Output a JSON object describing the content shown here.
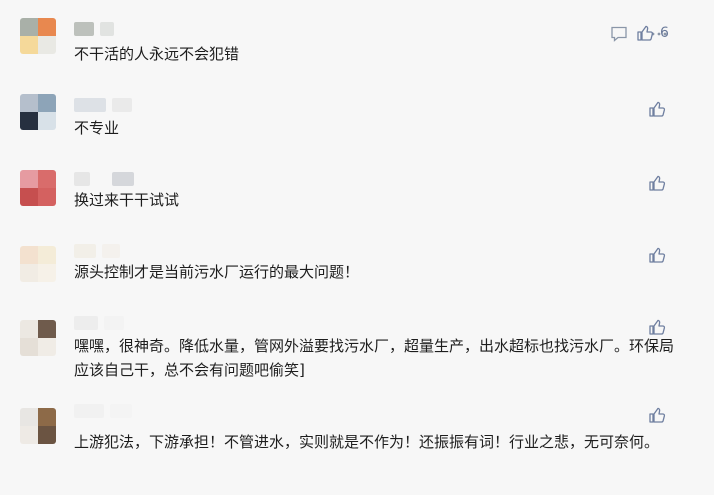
{
  "comments": [
    {
      "text": "不干活的人永远不会犯错",
      "likes": "6",
      "avatar_colors": [
        "#a9b0a8",
        "#e8884f",
        "#f5d99a",
        "#e9e9e4"
      ],
      "nick_colors": [
        "#8e968c",
        "#cfd3cf"
      ],
      "actions": true
    },
    {
      "text": "不专业",
      "likes": "",
      "avatar_colors": [
        "#b5bfcc",
        "#8da4b8",
        "#263040",
        "#d8e1e8"
      ],
      "nick_colors": [
        "#c9d0d8",
        "#e0e0e0"
      ],
      "actions": false
    },
    {
      "text": "换过来干干试试",
      "likes": "",
      "avatar_colors": [
        "#e69ba1",
        "#d96c6b",
        "#c64f4f",
        "#d46160"
      ],
      "nick_colors": [
        "#d9d9d9",
        "#b9bec4"
      ],
      "actions": false
    },
    {
      "text": "源头控制才是当前污水厂运行的最大问题！",
      "likes": "",
      "avatar_colors": [
        "#f3e1cf",
        "#f4ecd8",
        "#f1ece4",
        "#f6f1e8"
      ],
      "nick_colors": [
        "#efe9dd",
        "#f2ede6"
      ],
      "actions": false
    },
    {
      "text": "嘿嘿，很神奇。降低水量，管网外溢要找污水厂，超量生产，出水超标也找污水厂。环保局应该自己干，总不会有问题吧偷笑]",
      "likes": "",
      "avatar_colors": [
        "#ece8e2",
        "#6f5b4c",
        "#e5dfd7",
        "#f0ece6"
      ],
      "nick_colors": [
        "#e6e6e6",
        "#f0f0f0"
      ],
      "actions": false
    },
    {
      "text": "上游犯法，下游承担！不管进水，实则就是不作为！还振振有词！行业之悲，无可奈何。",
      "likes": "",
      "avatar_colors": [
        "#e8e6e3",
        "#8d6a48",
        "#eeeae5",
        "#6b5442"
      ],
      "nick_colors": [
        "#ececec",
        "#f2f2f2"
      ],
      "actions": false
    }
  ]
}
